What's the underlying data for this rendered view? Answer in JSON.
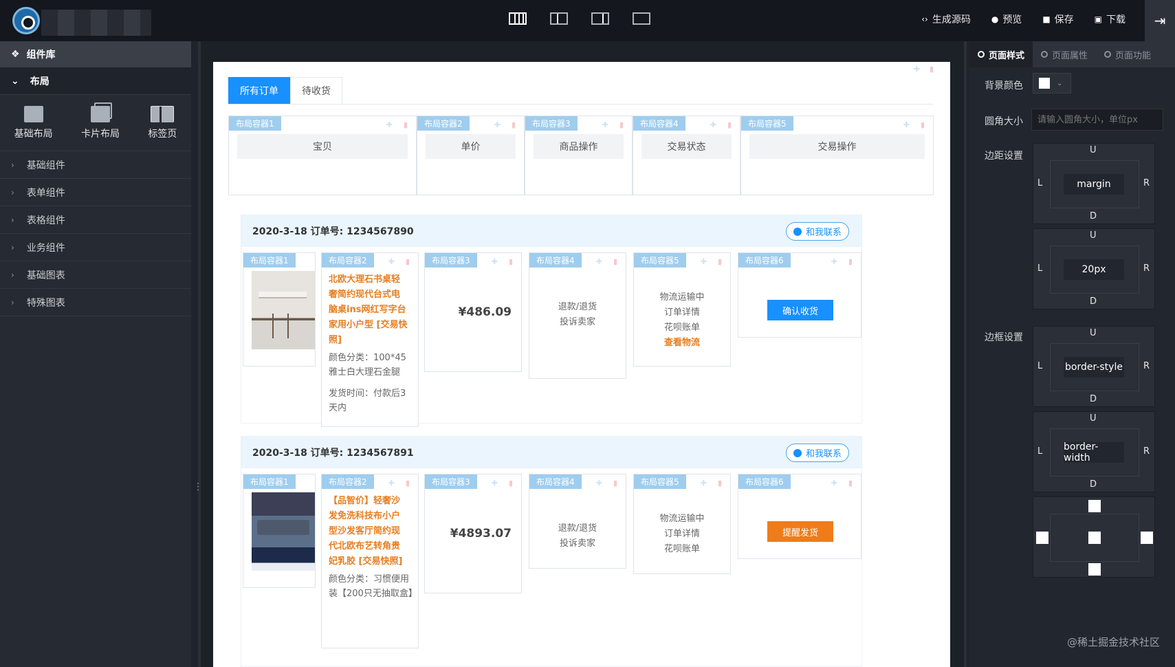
{
  "topbar": {
    "actions": [
      {
        "icon": "code-icon",
        "symbol": "‹›",
        "label": "生成源码"
      },
      {
        "icon": "eye-icon",
        "symbol": "●",
        "label": "预览"
      },
      {
        "icon": "folder-icon",
        "symbol": "■",
        "label": "保存"
      },
      {
        "icon": "download-icon",
        "symbol": "▣",
        "label": "下载"
      }
    ],
    "exit_symbol": "⇥"
  },
  "sidebar": {
    "header": "组件库",
    "layout_section": "布局",
    "layouts": [
      "基础布局",
      "卡片布局",
      "标签页"
    ],
    "groups": [
      "基础组件",
      "表单组件",
      "表格组件",
      "业务组件",
      "基础图表",
      "特殊图表"
    ]
  },
  "canvas": {
    "tabs": [
      "所有订单",
      "待收货"
    ],
    "header_containers": [
      {
        "tag": "布局容器1",
        "label": "宝贝"
      },
      {
        "tag": "布局容器2",
        "label": "单价"
      },
      {
        "tag": "布局容器3",
        "label": "商品操作"
      },
      {
        "tag": "布局容器4",
        "label": "交易状态"
      },
      {
        "tag": "布局容器5",
        "label": "交易操作"
      }
    ],
    "container_tags": [
      "布局容器1",
      "布局容器2",
      "布局容器3",
      "布局容器4",
      "布局容器5",
      "布局容器6"
    ],
    "orders": [
      {
        "header": "2020-3-18 订单号: 1234567890",
        "contact": "和我联系",
        "title": "北欧大理石书桌轻奢简约现代台式电脑桌ins网红写字台家用小户型 [交易快照]",
        "spec": "颜色分类：100*45雅士白大理石金腿",
        "ship": "发货时间：付款后3天内",
        "price": "¥486.09",
        "ops": [
          "退款/退货",
          "投诉卖家"
        ],
        "status": [
          "物流运输中",
          "订单详情",
          "花呗账单"
        ],
        "status_link": "查看物流",
        "action": "确认收货"
      },
      {
        "header": "2020-3-18 订单号: 1234567891",
        "contact": "和我联系",
        "title": "【品智价】轻奢沙发免洗科技布小户型沙发客厅简约现代北欧布艺转角贵妃乳胶 [交易快照]",
        "spec": "颜色分类：习惯便用装【200只无抽取盒】",
        "price": "¥4893.07",
        "ops": [
          "退款/退货",
          "投诉卖家"
        ],
        "status": [
          "物流运输中",
          "订单详情",
          "花呗账单"
        ],
        "action": "提醒发货"
      }
    ]
  },
  "rightpanel": {
    "tabs": [
      "页面样式",
      "页面属性",
      "页面功能"
    ],
    "bg_label": "背景颜色",
    "radius_label": "圆角大小",
    "radius_placeholder": "请输入圆角大小，单位px",
    "margin_label": "边距设置",
    "border_label": "边框设置",
    "dir": {
      "u": "U",
      "d": "D",
      "l": "L",
      "r": "R"
    },
    "margin_value": "margin",
    "padding_value": "20px",
    "border_style": "border-style",
    "border_width": "border-width"
  },
  "watermark": "@稀土掘金技术社区"
}
